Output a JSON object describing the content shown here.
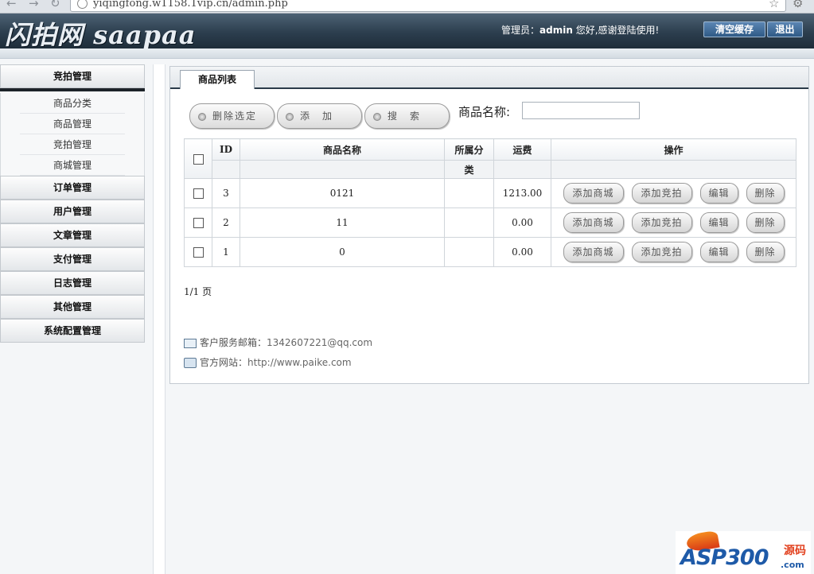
{
  "browser": {
    "url": "yiqingfong.w1158.1vip.cn/admin.php"
  },
  "header": {
    "logo_text": "闪拍网 saapaa",
    "admin_prefix": "管理员：",
    "admin_name": "admin",
    "admin_suffix": " 您好,感谢登陆使用!",
    "clear_cache_label": "清空缓存",
    "logout_label": "退出"
  },
  "sidebar": {
    "sections": [
      {
        "label": "竞拍管理"
      },
      {
        "label": "订单管理"
      },
      {
        "label": "用户管理"
      },
      {
        "label": "文章管理"
      },
      {
        "label": "支付管理"
      },
      {
        "label": "日志管理"
      },
      {
        "label": "其他管理"
      },
      {
        "label": "系统配置管理"
      }
    ],
    "subitems": [
      {
        "label": "商品分类"
      },
      {
        "label": "商品管理"
      },
      {
        "label": "竞拍管理"
      },
      {
        "label": "商城管理"
      }
    ]
  },
  "main": {
    "tab_label": "商品列表",
    "toolbar": {
      "delete_selected_label": "删除选定",
      "add_label": "添　加",
      "search_label": "搜　索",
      "name_label": "商品名称:",
      "name_value": ""
    },
    "table": {
      "headers": {
        "id": "ID",
        "name": "商品名称",
        "category_line1": "所属分",
        "category_line2": "类",
        "shipping": "运费",
        "actions": "操作"
      },
      "rows": [
        {
          "id": "3",
          "name": "0121",
          "category": "",
          "shipping": "1213.00"
        },
        {
          "id": "2",
          "name": "11",
          "category": "",
          "shipping": "0.00"
        },
        {
          "id": "1",
          "name": "0",
          "category": "",
          "shipping": "0.00"
        }
      ],
      "actions": {
        "add_mall": "添加商城",
        "add_auction": "添加竞拍",
        "edit": "编辑",
        "delete": "删除"
      }
    },
    "pager": "1/1 页",
    "contact": {
      "email_label": "客户服务邮箱：",
      "email_value": "1342607221@qq.com",
      "site_label": "官方网站：",
      "site_value": "http://www.paike.com"
    }
  },
  "watermark": {
    "text": "ASP300",
    "side": "源码",
    "domain": ".com"
  },
  "colors": {
    "header_bg": "#2c3e4e",
    "header_button": "#3f6a96",
    "panel_border": "#c3cad1"
  }
}
